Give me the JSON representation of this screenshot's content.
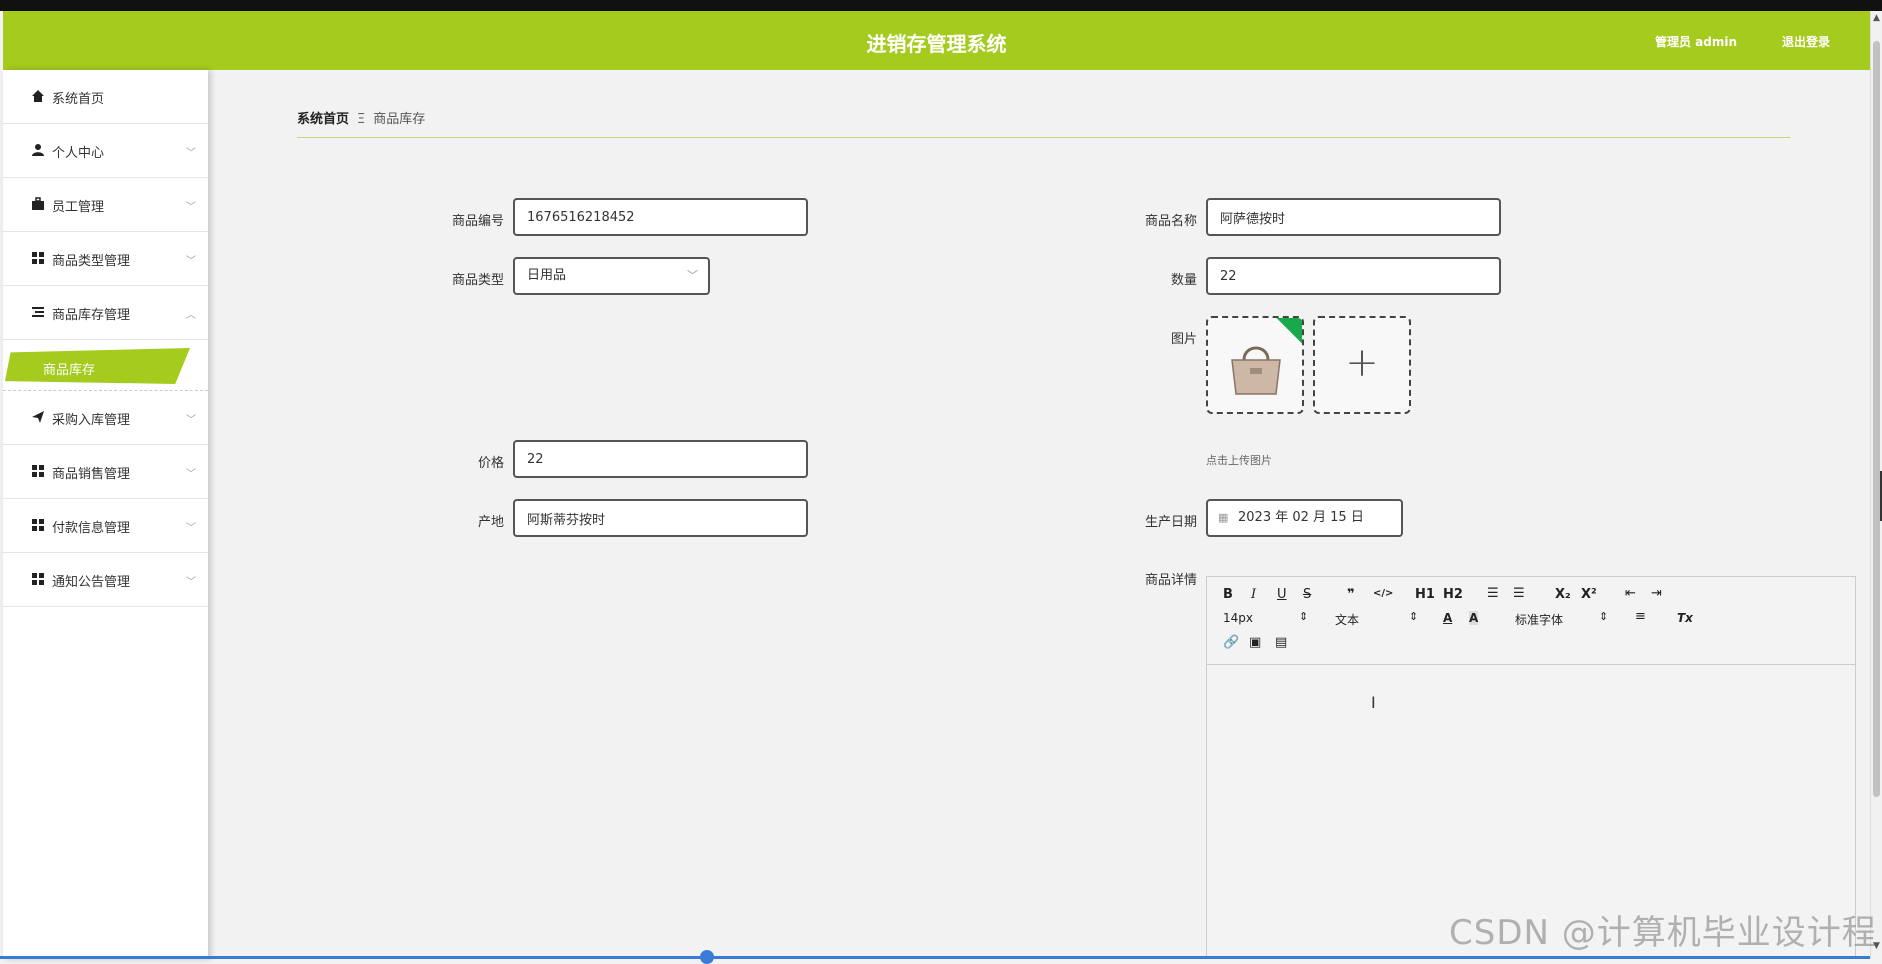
{
  "header": {
    "title": "进销存管理系统",
    "admin_label": "管理员 admin",
    "logout_label": "退出登录"
  },
  "sidebar": {
    "items": [
      {
        "label": "系统首页",
        "icon": "home-icon"
      },
      {
        "label": "个人中心",
        "icon": "user-icon"
      },
      {
        "label": "员工管理",
        "icon": "briefcase-icon"
      },
      {
        "label": "商品类型管理",
        "icon": "grid-icon"
      },
      {
        "label": "商品库存管理",
        "icon": "list-icon",
        "expanded": true
      },
      {
        "label": "采购入库管理",
        "icon": "send-icon"
      },
      {
        "label": "商品销售管理",
        "icon": "grid-icon"
      },
      {
        "label": "付款信息管理",
        "icon": "grid-icon"
      },
      {
        "label": "通知公告管理",
        "icon": "grid-icon"
      }
    ],
    "submenu_active": "商品库存"
  },
  "breadcrumb": {
    "home": "系统首页",
    "separator": "Ξ",
    "current": "商品库存"
  },
  "form": {
    "code_label": "商品编号",
    "code_value": "1676516218452",
    "name_label": "商品名称",
    "name_value": "阿萨德按时",
    "type_label": "商品类型",
    "type_value": "日用品",
    "qty_label": "数量",
    "qty_value": "22",
    "image_label": "图片",
    "upload_hint": "点击上传图片",
    "price_label": "价格",
    "price_value": "22",
    "origin_label": "产地",
    "origin_value": "阿斯蒂芬按时",
    "date_label": "生产日期",
    "date_value": "2023 年 02 月 15 日",
    "detail_label": "商品详情"
  },
  "editor": {
    "font_size": "14px",
    "text_type": "文本",
    "font_family": "标准字体",
    "buttons": [
      "B",
      "I",
      "U",
      "S",
      "❞",
      "</>",
      "H1",
      "H2",
      "ordered-list",
      "bullet-list",
      "X₂",
      "X²",
      "outdent",
      "indent"
    ],
    "row2_buttons": [
      "A",
      "A"
    ],
    "clear_format": "Tx"
  },
  "watermark": "CSDN @计算机毕业设计程",
  "colors": {
    "accent": "#a5cb1f",
    "upload_corner": "#19a84b"
  }
}
